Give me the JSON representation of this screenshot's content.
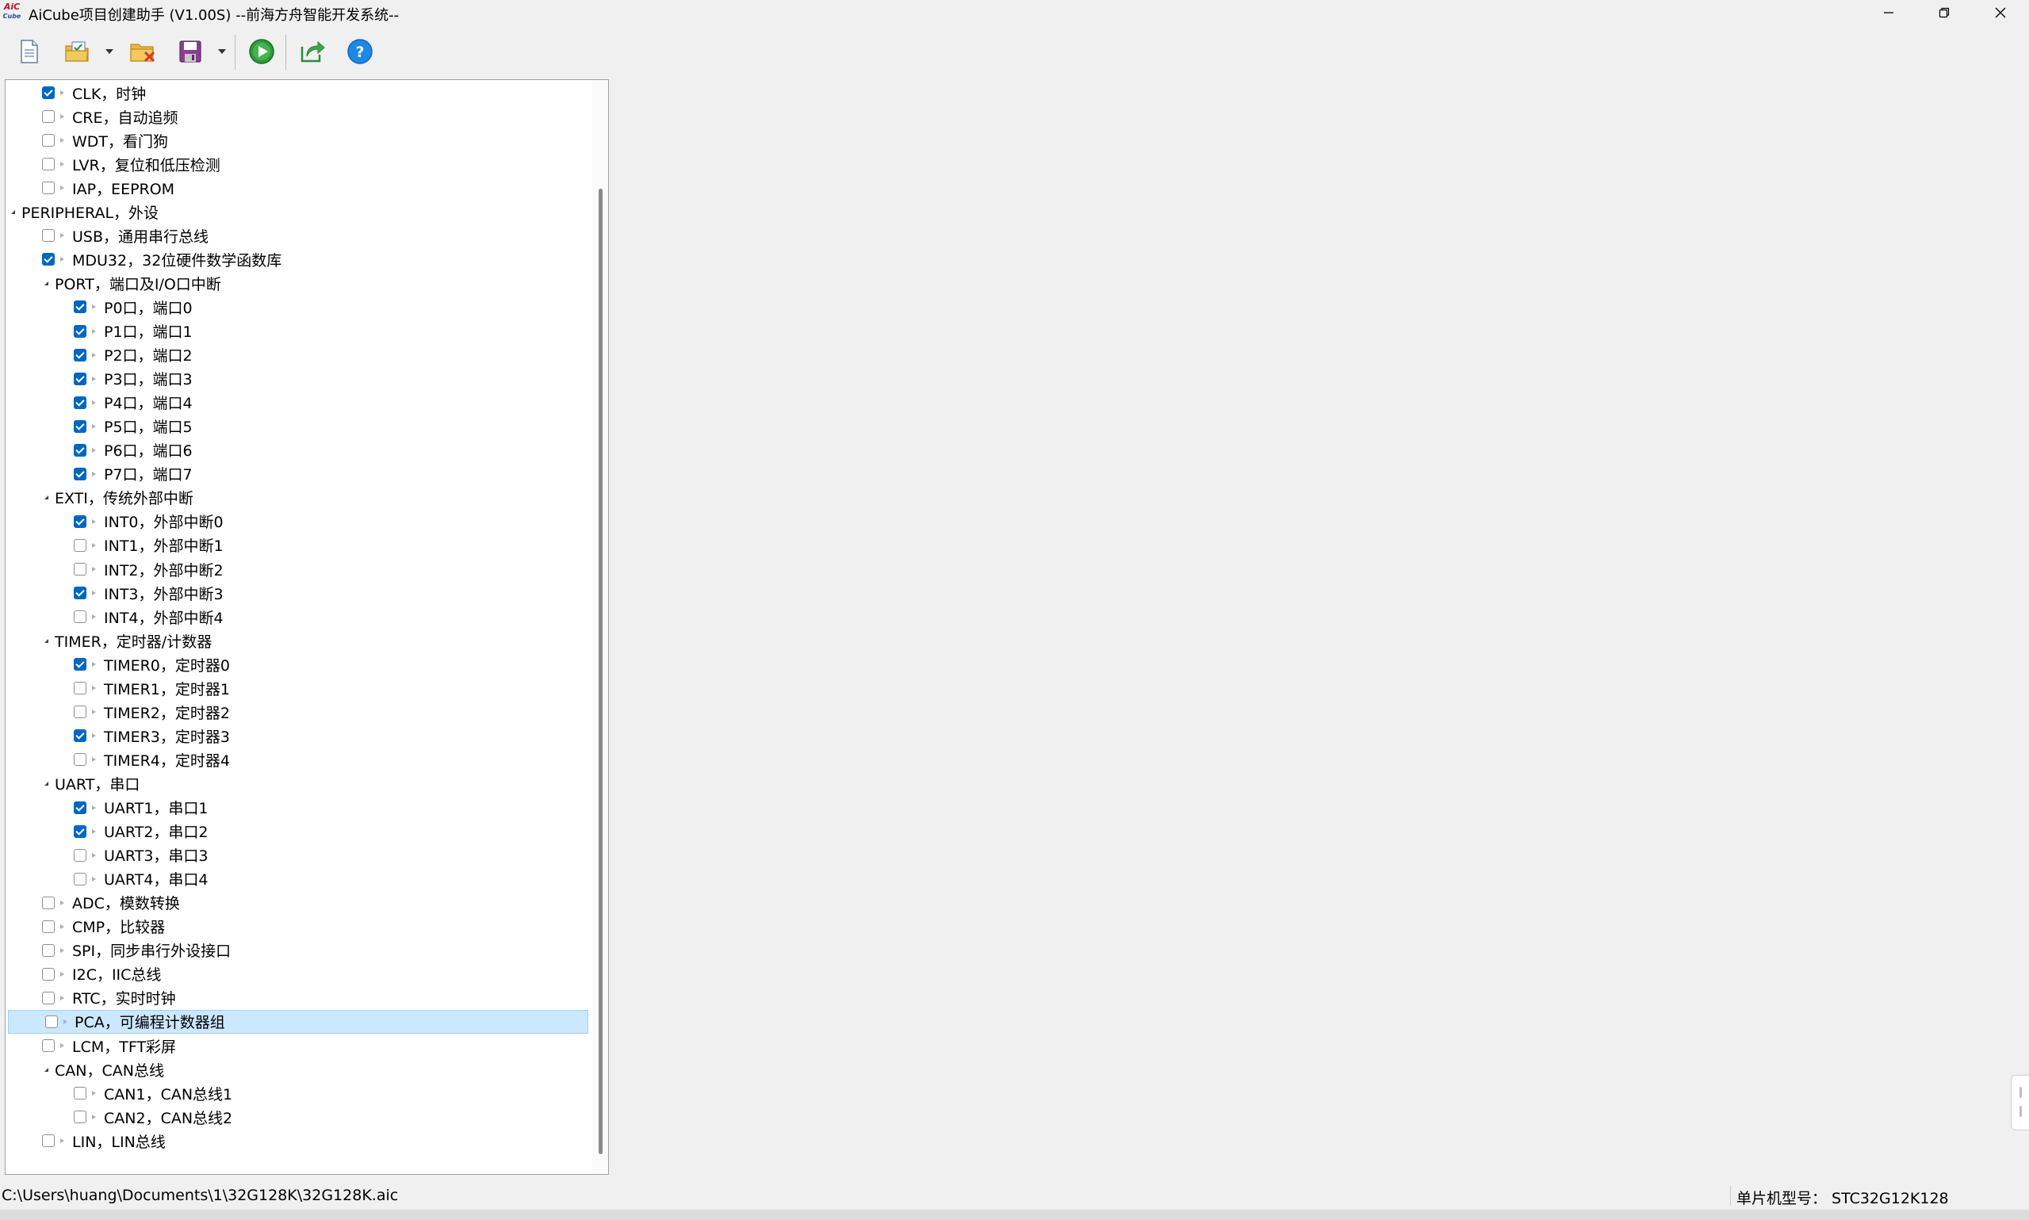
{
  "window": {
    "app_icon_line1": "AiC",
    "app_icon_line2": "Cube",
    "title": "AiCube项目创建助手 (V1.00S) --前海方舟智能开发系统--"
  },
  "toolbar": {
    "buttons": [
      {
        "icon": "new-document-icon"
      },
      {
        "icon": "open-folder-icon",
        "has_dropdown": true
      },
      {
        "icon": "close-project-icon"
      },
      {
        "icon": "save-icon",
        "has_dropdown": true
      },
      {
        "icon": "run-icon"
      },
      {
        "icon": "export-icon"
      },
      {
        "icon": "help-icon"
      }
    ]
  },
  "tree": [
    {
      "label": "CLK，时钟",
      "checked": true
    },
    {
      "label": "CRE，自动追频",
      "checked": false
    },
    {
      "label": "WDT，看门狗",
      "checked": false
    },
    {
      "label": "LVR，复位和低压检测",
      "checked": false
    },
    {
      "label": "IAP，EEPROM",
      "checked": false
    },
    {
      "label": "PERIPHERAL，外设"
    },
    {
      "label": "USB，通用串行总线",
      "checked": false
    },
    {
      "label": "MDU32，32位硬件数学函数库",
      "checked": true
    },
    {
      "label": "PORT，端口及I/O口中断"
    },
    {
      "label": "P0口，端口0",
      "checked": true
    },
    {
      "label": "P1口，端口1",
      "checked": true
    },
    {
      "label": "P2口，端口2",
      "checked": true
    },
    {
      "label": "P3口，端口3",
      "checked": true
    },
    {
      "label": "P4口，端口4",
      "checked": true
    },
    {
      "label": "P5口，端口5",
      "checked": true
    },
    {
      "label": "P6口，端口6",
      "checked": true
    },
    {
      "label": "P7口，端口7",
      "checked": true
    },
    {
      "label": "EXTI，传统外部中断"
    },
    {
      "label": "INT0，外部中断0",
      "checked": true
    },
    {
      "label": "INT1，外部中断1",
      "checked": false
    },
    {
      "label": "INT2，外部中断2",
      "checked": false
    },
    {
      "label": "INT3，外部中断3",
      "checked": true
    },
    {
      "label": "INT4，外部中断4",
      "checked": false
    },
    {
      "label": "TIMER，定时器/计数器"
    },
    {
      "label": "TIMER0，定时器0",
      "checked": true
    },
    {
      "label": "TIMER1，定时器1",
      "checked": false
    },
    {
      "label": "TIMER2，定时器2",
      "checked": false
    },
    {
      "label": "TIMER3，定时器3",
      "checked": true
    },
    {
      "label": "TIMER4，定时器4",
      "checked": false
    },
    {
      "label": "UART，串口"
    },
    {
      "label": "UART1，串口1",
      "checked": true
    },
    {
      "label": "UART2，串口2",
      "checked": true
    },
    {
      "label": "UART3，串口3",
      "checked": false
    },
    {
      "label": "UART4，串口4",
      "checked": false
    },
    {
      "label": "ADC，模数转换",
      "checked": false
    },
    {
      "label": "CMP，比较器",
      "checked": false
    },
    {
      "label": "SPI，同步串行外设接口",
      "checked": false
    },
    {
      "label": "I2C，IIC总线",
      "checked": false
    },
    {
      "label": "RTC，实时时钟",
      "checked": false
    },
    {
      "label": "PCA，可编程计数器组",
      "checked": false,
      "selected": true
    },
    {
      "label": "LCM，TFT彩屏",
      "checked": false
    },
    {
      "label": "CAN，CAN总线"
    },
    {
      "label": "CAN1，CAN总线1",
      "checked": false
    },
    {
      "label": "CAN2，CAN总线2",
      "checked": false
    },
    {
      "label": "LIN，LIN总线",
      "checked": false
    }
  ],
  "status": {
    "path": "C:\\Users\\huang\\Documents\\1\\32G128K\\32G128K.aic",
    "mcu_label": "单片机型号：",
    "mcu_value": "STC32G12K128"
  },
  "colors": {
    "accent": "#0067c0",
    "selection_bg": "#cce8ff",
    "selection_border": "#99d1ff"
  }
}
